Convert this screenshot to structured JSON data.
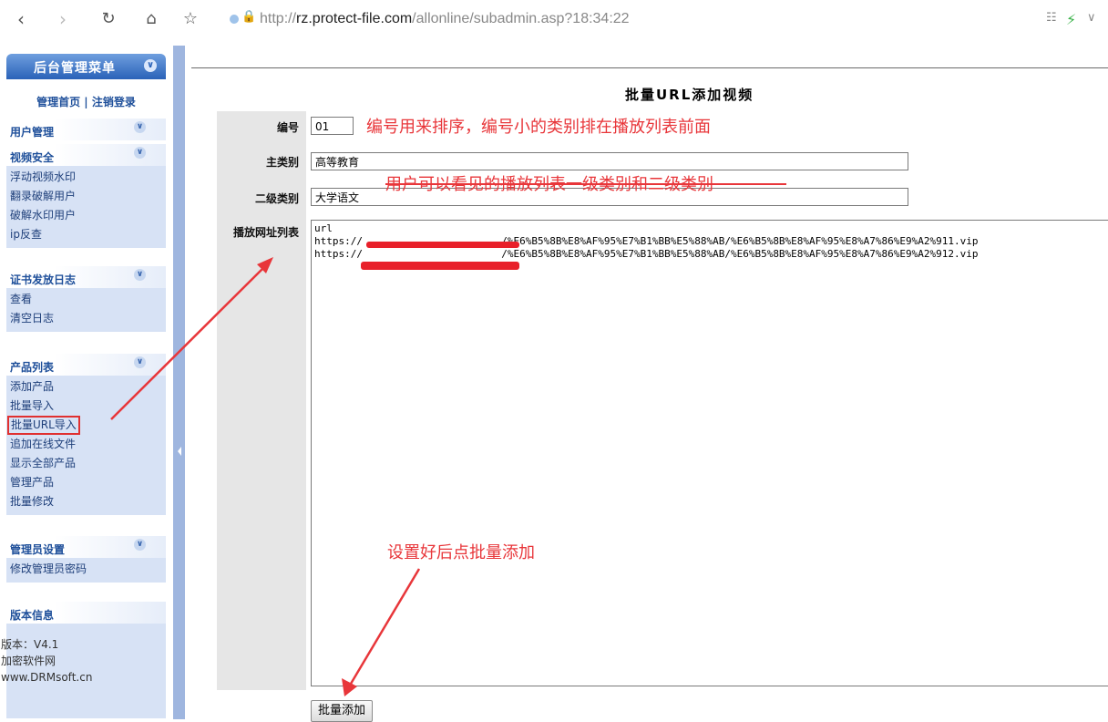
{
  "browser": {
    "url_prefix": "http://",
    "url_host": "rz.protect-file.com",
    "url_path": "/allonline/subadmin.asp?18:34:22"
  },
  "sidebar": {
    "header_title": "后台管理菜单",
    "links": "管理首页 | 注销登录",
    "sections": [
      {
        "title": "用户管理",
        "items": []
      },
      {
        "title": "视频安全",
        "items": [
          "浮动视频水印",
          "翻录破解用户",
          "破解水印用户",
          "ip反查"
        ]
      },
      {
        "title": "证书发放日志",
        "items": [
          "查看",
          "清空日志"
        ]
      },
      {
        "title": "产品列表",
        "items": [
          "添加产品",
          "批量导入",
          "批量URL导入",
          "追加在线文件",
          "显示全部产品",
          "管理产品",
          "批量修改"
        ]
      },
      {
        "title": "管理员设置",
        "items": [
          "修改管理员密码"
        ]
      }
    ],
    "version": {
      "title": "版本信息",
      "lines": [
        "版本：V4.1",
        "加密软件网",
        "www.DRMsoft.cn"
      ]
    }
  },
  "form": {
    "title": "批量URL添加视频",
    "fields": {
      "number": {
        "label": "编号",
        "value": "01"
      },
      "main_category": {
        "label": "主类别",
        "value": "高等教育"
      },
      "sub_category": {
        "label": "二级类别",
        "value": "大学语文"
      },
      "url_list": {
        "label": "播放网址列表",
        "lines": [
          "url",
          "https://                       /%E6%B5%8B%E8%AF%95%E7%B1%BB%E5%88%AB/%E6%B5%8B%E8%AF%95%E8%A7%86%E9%A2%911.vip",
          "https://                       /%E6%B5%8B%E8%AF%95%E7%B1%BB%E5%88%AB/%E6%B5%8B%E8%AF%95%E8%A7%86%E9%A2%912.vip"
        ]
      }
    },
    "submit_label": "批量添加"
  },
  "annotations": {
    "number_note": "编号用来排序，编号小的类别排在播放列表前面",
    "category_note": "用户可以看见的播放列表一级类别和二级类别",
    "submit_note": "设置好后点批量添加"
  },
  "colors": {
    "annotation": "#e8363a",
    "sidebar_header": "#2a62b8",
    "sidebar_items_bg": "#d7e2f5"
  }
}
